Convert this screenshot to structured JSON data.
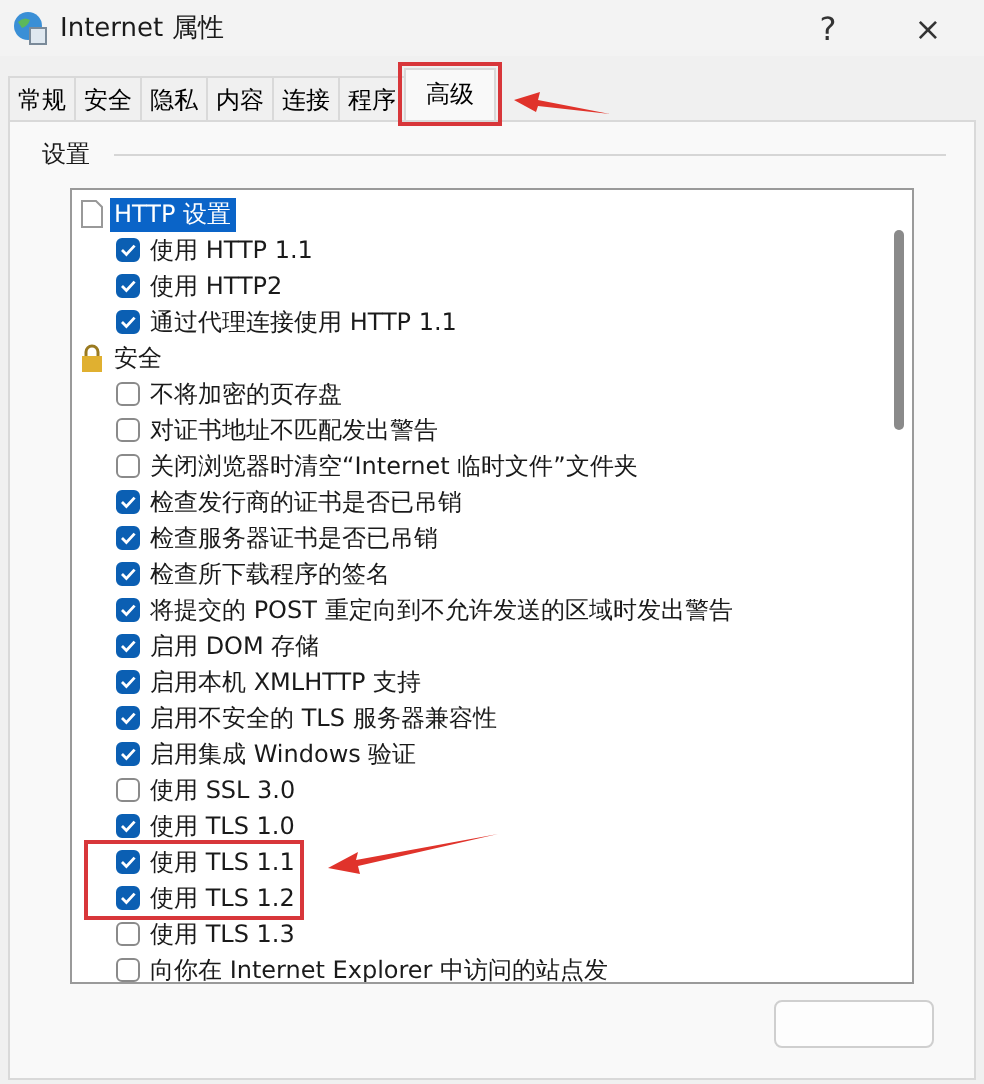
{
  "window": {
    "title": "Internet 属性",
    "help": "?",
    "close": "×"
  },
  "tabs": [
    {
      "label": "常规",
      "selected": false,
      "highlighted": false
    },
    {
      "label": "安全",
      "selected": false,
      "highlighted": false
    },
    {
      "label": "隐私",
      "selected": false,
      "highlighted": false
    },
    {
      "label": "内容",
      "selected": false,
      "highlighted": false
    },
    {
      "label": "连接",
      "selected": false,
      "highlighted": false
    },
    {
      "label": "程序",
      "selected": false,
      "highlighted": false
    },
    {
      "label": "高级",
      "selected": true,
      "highlighted": true
    }
  ],
  "settings": {
    "label": "设置",
    "groups": [
      {
        "label": "HTTP 设置",
        "kind": "general",
        "selected": true,
        "children": [
          {
            "label": "使用 HTTP 1.1",
            "checked": true,
            "highlighted": false
          },
          {
            "label": "使用 HTTP2",
            "checked": true,
            "highlighted": false
          },
          {
            "label": "通过代理连接使用 HTTP 1.1",
            "checked": true,
            "highlighted": false
          }
        ]
      },
      {
        "label": "安全",
        "kind": "security",
        "selected": false,
        "children": [
          {
            "label": "不将加密的页存盘",
            "checked": false,
            "highlighted": false
          },
          {
            "label": "对证书地址不匹配发出警告",
            "checked": false,
            "highlighted": false
          },
          {
            "label": "关闭浏览器时清空“Internet 临时文件”文件夹",
            "checked": false,
            "highlighted": false
          },
          {
            "label": "检查发行商的证书是否已吊销",
            "checked": true,
            "highlighted": false
          },
          {
            "label": "检查服务器证书是否已吊销",
            "checked": true,
            "highlighted": false
          },
          {
            "label": "检查所下载程序的签名",
            "checked": true,
            "highlighted": false
          },
          {
            "label": "将提交的 POST 重定向到不允许发送的区域时发出警告",
            "checked": true,
            "highlighted": false
          },
          {
            "label": "启用 DOM 存储",
            "checked": true,
            "highlighted": false
          },
          {
            "label": "启用本机 XMLHTTP 支持",
            "checked": true,
            "highlighted": false
          },
          {
            "label": "启用不安全的 TLS 服务器兼容性",
            "checked": true,
            "highlighted": false
          },
          {
            "label": "启用集成 Windows 验证",
            "checked": true,
            "highlighted": false
          },
          {
            "label": "使用 SSL 3.0",
            "checked": false,
            "highlighted": false
          },
          {
            "label": "使用 TLS 1.0",
            "checked": true,
            "highlighted": false
          },
          {
            "label": "使用 TLS 1.1",
            "checked": true,
            "highlighted": true
          },
          {
            "label": "使用 TLS 1.2",
            "checked": true,
            "highlighted": true
          },
          {
            "label": "使用 TLS 1.3",
            "checked": false,
            "highlighted": false
          },
          {
            "label": "向你在 Internet Explorer 中访问的站点发",
            "checked": false,
            "highlighted": false
          }
        ]
      }
    ]
  }
}
